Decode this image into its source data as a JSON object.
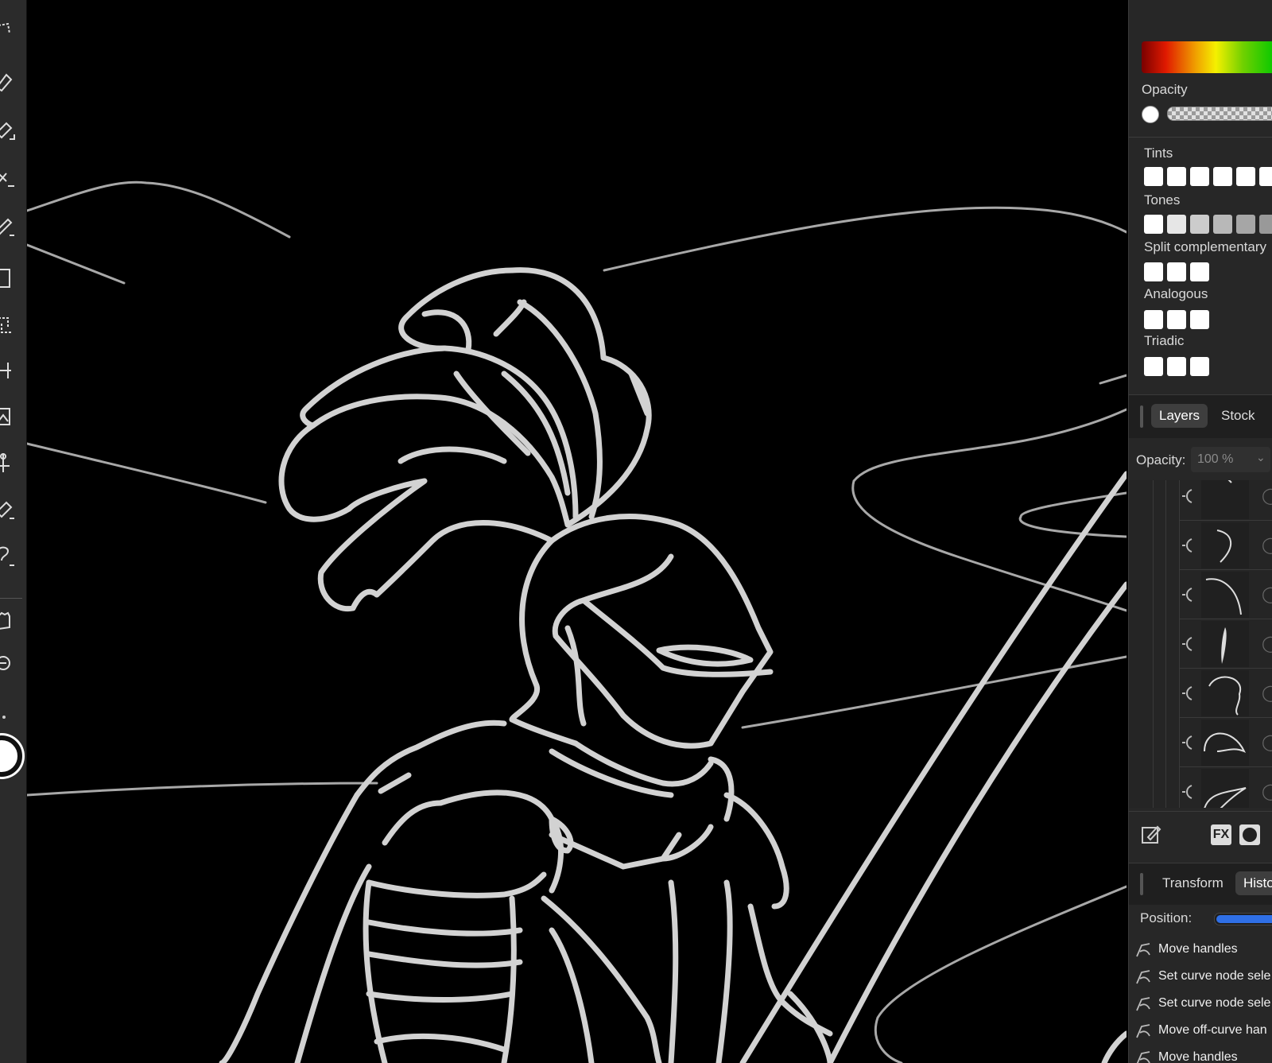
{
  "toolbar": {
    "tools": [
      "move-tool-icon",
      "pen-tool-icon",
      "pencil-tool-icon",
      "vector-brush-icon",
      "brush-tool-icon",
      "frame-tool-icon",
      "crop-tool-icon",
      "artboard-tool-icon",
      "image-tool-icon",
      "node-tool-icon",
      "eraser-tool-icon",
      "fill-tool-icon",
      "hand-tool-icon",
      "zoom-tool-icon"
    ]
  },
  "color_panel": {
    "opacity_label": "Opacity",
    "tints_label": "Tints",
    "tones_label": "Tones",
    "split_label": "Split complementary",
    "analogous_label": "Analogous",
    "triadic_label": "Triadic",
    "tones_colors": [
      "#ffffff",
      "#e6e6e6",
      "#cccccc",
      "#b8b8b8",
      "#a6a6a6",
      "#999999"
    ]
  },
  "layers_panel": {
    "tabs": [
      "Layers",
      "Stock"
    ],
    "active_tab": "Layers",
    "opacity_label": "Opacity:",
    "opacity_value": "100 %"
  },
  "bottom_tabs": {
    "tabs": [
      "Transform",
      "Histo"
    ],
    "active_tab": "Histo"
  },
  "history": {
    "position_label": "Position:",
    "position_value": 1.0,
    "items": [
      "Move handles",
      "Set curve node sele",
      "Set curve node sele",
      "Move off-curve han",
      "Move handles"
    ]
  },
  "colors": {
    "canvas": "#000000",
    "stroke": "#d0d0d0",
    "panel": "#272727",
    "accent": "#2f6fe6"
  }
}
